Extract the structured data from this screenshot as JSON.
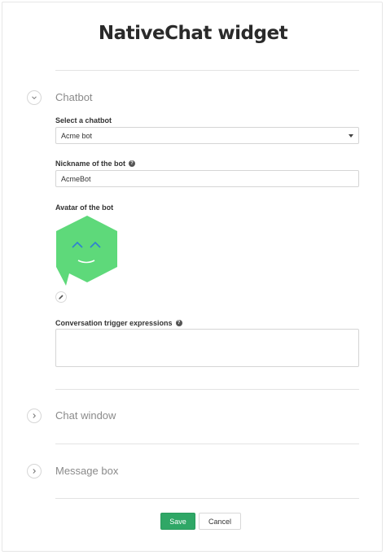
{
  "page": {
    "title": "NativeChat widget"
  },
  "sections": {
    "chatbot": {
      "title": "Chatbot",
      "expanded": true
    },
    "chat_window": {
      "title": "Chat window",
      "expanded": false
    },
    "message_box": {
      "title": "Message box",
      "expanded": false
    }
  },
  "chatbot_form": {
    "select_label": "Select a chatbot",
    "select_value": "Acme bot",
    "nickname_label": "Nickname of the bot",
    "nickname_value": "AcmeBot",
    "avatar_label": "Avatar of the bot",
    "trigger_label": "Conversation trigger expressions",
    "trigger_value": ""
  },
  "buttons": {
    "save": "Save",
    "cancel": "Cancel"
  },
  "colors": {
    "avatar_green": "#5ed97a",
    "avatar_eyes": "#2f7fd3",
    "save_green": "#2fa766"
  },
  "icons": {
    "section_expanded": "chevron-down-icon",
    "section_collapsed": "chevron-right-icon",
    "help": "question-circle-icon",
    "edit": "pencil-icon",
    "select": "caret-down-icon"
  }
}
